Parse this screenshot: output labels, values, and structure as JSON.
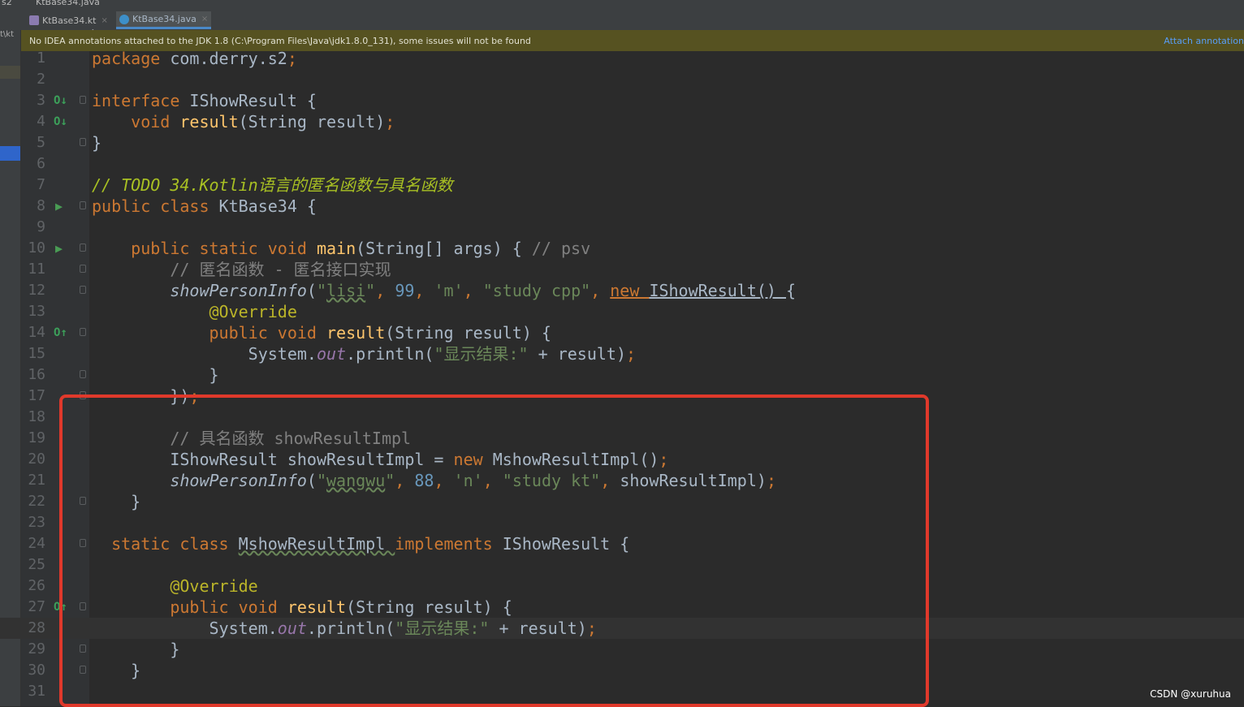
{
  "breadcrumb": {
    "project": "s2",
    "file": "KtBase34.java"
  },
  "tabs": [
    {
      "label": "KtBase34.kt",
      "active": false
    },
    {
      "label": "KtBase34.java",
      "active": true
    }
  ],
  "left_strip_label": "t\\kt",
  "notice": {
    "message": "No IDEA annotations attached to the JDK 1.8 (C:\\Program Files\\Java\\jdk1.8.0_131), some issues will not be found",
    "action": "Attach annotation"
  },
  "code_lines": [
    {
      "num": "1",
      "t": [
        [
          "kw",
          "package "
        ],
        [
          "",
          "com.derry.s2"
        ],
        [
          "kw",
          ";"
        ]
      ]
    },
    {
      "num": "2",
      "t": []
    },
    {
      "num": "3",
      "t": [
        [
          "kw",
          "interface "
        ],
        [
          "",
          "IShowResult {"
        ]
      ]
    },
    {
      "num": "4",
      "t": [
        [
          "",
          "    "
        ],
        [
          "kw",
          "void "
        ],
        [
          "fn",
          "result"
        ],
        [
          "",
          "(String result)"
        ],
        [
          "kw",
          ";"
        ]
      ]
    },
    {
      "num": "5",
      "t": [
        [
          "",
          "}"
        ]
      ]
    },
    {
      "num": "6",
      "t": []
    },
    {
      "num": "7",
      "t": [
        [
          "todo",
          "// TODO 34.Kotlin语言的匿名函数与具名函数"
        ]
      ]
    },
    {
      "num": "8",
      "t": [
        [
          "kw",
          "public class "
        ],
        [
          "",
          "KtBase34 {"
        ]
      ]
    },
    {
      "num": "9",
      "t": []
    },
    {
      "num": "10",
      "t": [
        [
          "",
          "    "
        ],
        [
          "kw",
          "public static void "
        ],
        [
          "fn",
          "main"
        ],
        [
          "",
          "(String[] args) { "
        ],
        [
          "cmt",
          "// psv"
        ]
      ]
    },
    {
      "num": "11",
      "t": [
        [
          "",
          "        "
        ],
        [
          "cmt",
          "// 匿名函数 - 匿名接口实现"
        ]
      ]
    },
    {
      "num": "12",
      "t": [
        [
          "",
          "        "
        ],
        [
          "it",
          "showPersonInfo"
        ],
        [
          "",
          "("
        ],
        [
          "str",
          "\""
        ],
        [
          "str wavy",
          "lisi"
        ],
        [
          "str",
          "\""
        ],
        [
          "kw",
          ", "
        ],
        [
          "num",
          "99"
        ],
        [
          "kw",
          ", "
        ],
        [
          "str",
          "'m'"
        ],
        [
          "kw",
          ", "
        ],
        [
          "str",
          "\"study cpp\""
        ],
        [
          "kw",
          ", "
        ],
        [
          "kw ul",
          "new "
        ],
        [
          "ul",
          "IShowResult() "
        ],
        [
          "",
          "{"
        ]
      ]
    },
    {
      "num": "13",
      "t": [
        [
          "",
          "            "
        ],
        [
          "ann",
          "@Override"
        ]
      ]
    },
    {
      "num": "14",
      "t": [
        [
          "",
          "            "
        ],
        [
          "kw",
          "public void "
        ],
        [
          "fn",
          "result"
        ],
        [
          "",
          "(String result) {"
        ]
      ]
    },
    {
      "num": "15",
      "t": [
        [
          "",
          "                System."
        ],
        [
          "field",
          "out"
        ],
        [
          "",
          ".println("
        ],
        [
          "str",
          "\"显示结果:\""
        ],
        [
          "",
          " + result)"
        ],
        [
          "kw",
          ";"
        ]
      ]
    },
    {
      "num": "16",
      "t": [
        [
          "",
          "            }"
        ]
      ]
    },
    {
      "num": "17",
      "t": [
        [
          "",
          "        })"
        ],
        [
          "kw",
          ";"
        ]
      ]
    },
    {
      "num": "18",
      "t": []
    },
    {
      "num": "19",
      "t": [
        [
          "",
          "        "
        ],
        [
          "cmt",
          "// 具名函数 showResultImpl"
        ]
      ]
    },
    {
      "num": "20",
      "t": [
        [
          "",
          "        IShowResult showResultImpl = "
        ],
        [
          "kw",
          "new "
        ],
        [
          "",
          "MshowResultImpl()"
        ],
        [
          "kw",
          ";"
        ]
      ]
    },
    {
      "num": "21",
      "t": [
        [
          "",
          "        "
        ],
        [
          "it",
          "showPersonInfo"
        ],
        [
          "",
          "("
        ],
        [
          "str",
          "\""
        ],
        [
          "str wavy",
          "wangwu"
        ],
        [
          "str",
          "\""
        ],
        [
          "kw",
          ", "
        ],
        [
          "num",
          "88"
        ],
        [
          "kw",
          ", "
        ],
        [
          "str",
          "'n'"
        ],
        [
          "kw",
          ", "
        ],
        [
          "str",
          "\"study kt\""
        ],
        [
          "kw",
          ", "
        ],
        [
          "",
          "showResultImpl)"
        ],
        [
          "kw",
          ";"
        ]
      ]
    },
    {
      "num": "22",
      "t": [
        [
          "",
          "    }"
        ]
      ]
    },
    {
      "num": "23",
      "t": []
    },
    {
      "num": "24",
      "t": [
        [
          "",
          "  "
        ],
        [
          "kw",
          "static class "
        ],
        [
          "wavy",
          "MshowResultImpl "
        ],
        [
          "kw",
          "implements "
        ],
        [
          "",
          "IShowResult {"
        ]
      ]
    },
    {
      "num": "25",
      "t": []
    },
    {
      "num": "26",
      "t": [
        [
          "",
          "        "
        ],
        [
          "ann",
          "@Override"
        ]
      ]
    },
    {
      "num": "27",
      "t": [
        [
          "",
          "        "
        ],
        [
          "kw",
          "public void "
        ],
        [
          "fn",
          "result"
        ],
        [
          "",
          "(String result) {"
        ]
      ]
    },
    {
      "num": "28",
      "t": [
        [
          "",
          "            System."
        ],
        [
          "field",
          "out"
        ],
        [
          "",
          ".println("
        ],
        [
          "str",
          "\"显示结果:\""
        ],
        [
          "",
          " + result)"
        ],
        [
          "kw",
          ";"
        ]
      ]
    },
    {
      "num": "29",
      "t": [
        [
          "",
          "        }"
        ]
      ]
    },
    {
      "num": "30",
      "t": [
        [
          "",
          "    }"
        ]
      ]
    },
    {
      "num": "31",
      "t": []
    }
  ],
  "gutter_markers": {
    "implemented_icon_lines": [
      "3",
      "4"
    ],
    "override_icon_lines": [
      "14",
      "27"
    ],
    "run_icon_lines": [
      "8",
      "10"
    ],
    "fold_lines": [
      "3",
      "5",
      "8",
      "10",
      "11",
      "12",
      "14",
      "16",
      "17",
      "22",
      "24",
      "27",
      "29",
      "30"
    ],
    "current_line": "28"
  },
  "annotation_color": "#e0392b",
  "watermark": "CSDN @xuruhua"
}
